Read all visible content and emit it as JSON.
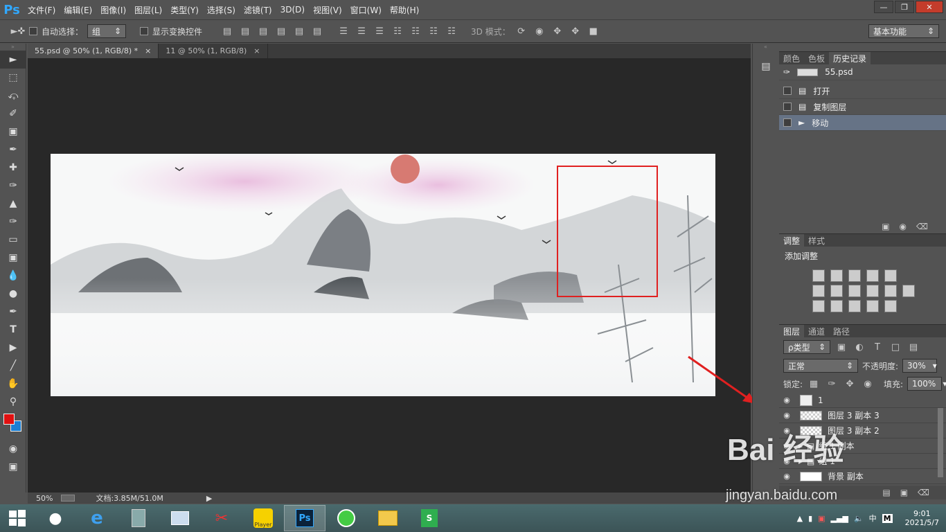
{
  "app": {
    "logo": "Ps"
  },
  "menu": [
    "文件(F)",
    "编辑(E)",
    "图像(I)",
    "图层(L)",
    "类型(Y)",
    "选择(S)",
    "滤镜(T)",
    "3D(D)",
    "视图(V)",
    "窗口(W)",
    "帮助(H)"
  ],
  "options": {
    "auto_select_label": "自动选择：",
    "auto_select_value": "组",
    "show_transform_label": "显示变换控件",
    "mode_3d_label": "3D 模式：",
    "workspace": "基本功能"
  },
  "tabs": [
    {
      "label": "55.psd @ 50% (1, RGB/8) *",
      "close": "×"
    },
    {
      "label": "11 @ 50% (1, RGB/8)",
      "close": "×"
    }
  ],
  "status": {
    "zoom": "50%",
    "doc": "文档:3.85M/51.0M"
  },
  "history_panel": {
    "tabs": [
      "颜色",
      "色板",
      "历史记录"
    ],
    "snapshot": "55.psd",
    "steps": [
      "打开",
      "复制图层",
      "移动"
    ]
  },
  "adjust_panel": {
    "tabs": [
      "调整",
      "样式"
    ],
    "title": "添加调整"
  },
  "layers_panel": {
    "tabs": [
      "图层",
      "通道",
      "路径"
    ],
    "filter": "ρ类型",
    "blend_mode": "正常",
    "opacity_label": "不透明度:",
    "opacity": "30%",
    "lock_label": "锁定:",
    "fill_label": "填充:",
    "fill": "100%",
    "layers": [
      "1",
      "图层 3 副本 3",
      "图层 3 副本 2",
      "组 1 副本",
      "组 1",
      "背景 副本"
    ]
  },
  "watermark": {
    "line1": "Bai 经验",
    "line2": "jingyan.baidu.com"
  },
  "taskbar": {
    "player_label": "Player",
    "time": "9:01",
    "date": "2021/5/7"
  },
  "colors": {
    "foreground": "#e01010",
    "background": "#1a7fd4",
    "annotation": "#e02020"
  }
}
